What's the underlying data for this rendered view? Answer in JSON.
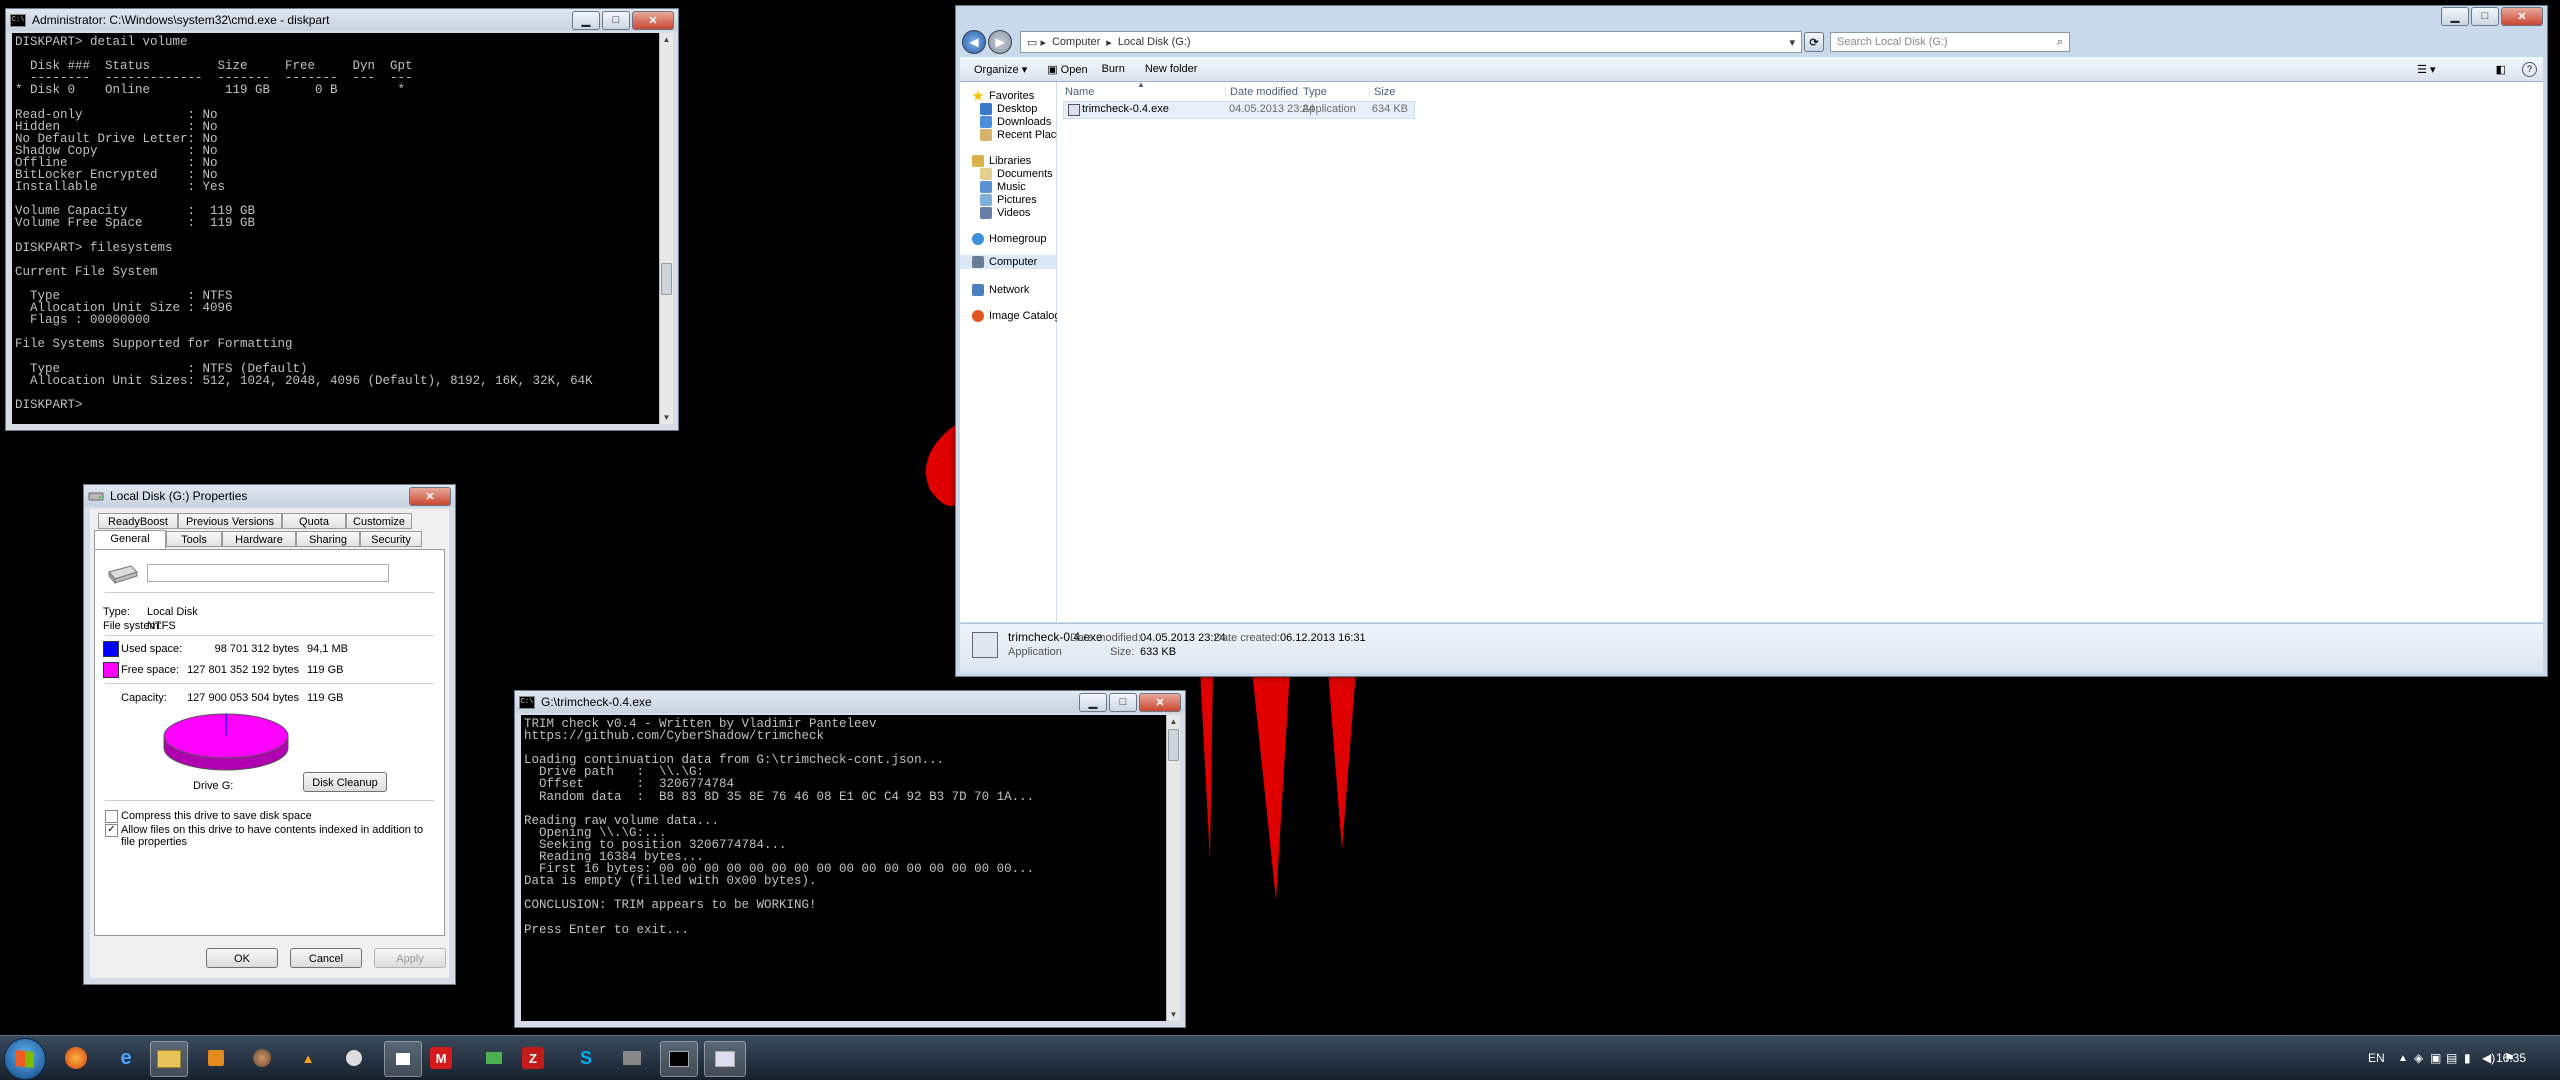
{
  "cmd_window": {
    "title": "Administrator: C:\\Windows\\system32\\cmd.exe - diskpart",
    "lines": [
      "DISKPART> detail volume",
      "",
      "  Disk ###  Status         Size     Free     Dyn  Gpt",
      "  --------  -------------  -------  -------  ---  ---",
      "* Disk 0    Online          119 GB      0 B        *",
      "",
      "Read-only              : No",
      "Hidden                 : No",
      "No Default Drive Letter: No",
      "Shadow Copy            : No",
      "Offline                : No",
      "BitLocker Encrypted    : No",
      "Installable            : Yes",
      "",
      "Volume Capacity        :  119 GB",
      "Volume Free Space      :  119 GB",
      "",
      "DISKPART> filesystems",
      "",
      "Current File System",
      "",
      "  Type                 : NTFS",
      "  Allocation Unit Size : 4096",
      "  Flags : 00000000",
      "",
      "File Systems Supported for Formatting",
      "",
      "  Type                 : NTFS (Default)",
      "  Allocation Unit Sizes: 512, 1024, 2048, 4096 (Default), 8192, 16K, 32K, 64K",
      "",
      "DISKPART>"
    ]
  },
  "trim_window": {
    "title": "G:\\trimcheck-0.4.exe",
    "lines": [
      "TRIM check v0.4 - Written by Vladimir Panteleev",
      "https://github.com/CyberShadow/trimcheck",
      "",
      "Loading continuation data from G:\\trimcheck-cont.json...",
      "  Drive path   :  \\\\.\\G:",
      "  Offset       :  3206774784",
      "  Random data  :  B8 83 8D 35 8E 76 46 08 E1 0C C4 92 B3 7D 70 1A...",
      "",
      "Reading raw volume data...",
      "  Opening \\\\.\\G:...",
      "  Seeking to position 3206774784...",
      "  Reading 16384 bytes...",
      "  First 16 bytes: 00 00 00 00 00 00 00 00 00 00 00 00 00 00 00 00...",
      "Data is empty (filled with 0x00 bytes).",
      "",
      "CONCLUSION: TRIM appears to be WORKING!",
      "",
      "Press Enter to exit..."
    ]
  },
  "properties": {
    "title": "Local Disk (G:) Properties",
    "tabs_row1": [
      "ReadyBoost",
      "Previous Versions",
      "Quota",
      "Customize"
    ],
    "tabs_row2": [
      "General",
      "Tools",
      "Hardware",
      "Sharing",
      "Security"
    ],
    "active_tab": "General",
    "volume_label": "",
    "type_label": "Type:",
    "type_value": "Local Disk",
    "fs_label": "File system:",
    "fs_value": "NTFS",
    "used_label": "Used space:",
    "used_bytes": "98 701 312 bytes",
    "used_size": "94,1 MB",
    "free_label": "Free space:",
    "free_bytes": "127 801 352 192 bytes",
    "free_size": "119 GB",
    "capacity_label": "Capacity:",
    "capacity_bytes": "127 900 053 504 bytes",
    "capacity_size": "119 GB",
    "drive_label": "Drive G:",
    "disk_cleanup": "Disk Cleanup",
    "compress_label": "Compress this drive to save disk space",
    "compress_checked": false,
    "index_label_1": "Allow files on this drive to have contents indexed in addition to",
    "index_label_2": "file properties",
    "index_checked": true,
    "ok": "OK",
    "cancel": "Cancel",
    "apply": "Apply",
    "used_fraction": 0.0008,
    "colors": {
      "used": "#0000ff",
      "free": "#ff00ff"
    }
  },
  "explorer": {
    "breadcrumb": [
      "Computer",
      "Local Disk (G:)"
    ],
    "search_placeholder": "Search Local Disk (G:)",
    "toolbar": {
      "organize": "Organize",
      "open": "Open",
      "burn": "Burn",
      "new_folder": "New folder"
    },
    "nav": {
      "favorites": "Favorites",
      "desktop": "Desktop",
      "downloads": "Downloads",
      "recent": "Recent Places",
      "libraries": "Libraries",
      "documents": "Documents",
      "music": "Music",
      "pictures": "Pictures",
      "videos": "Videos",
      "homegroup": "Homegroup",
      "computer": "Computer",
      "network": "Network",
      "image_catalog": "Image Catalog"
    },
    "columns": [
      "Name",
      "Date modified",
      "Type",
      "Size"
    ],
    "files": [
      {
        "name": "trimcheck-0.4.exe",
        "modified": "04.05.2013 23:24",
        "type": "Application",
        "size": "634 KB"
      }
    ],
    "details": {
      "name": "trimcheck-0.4.exe",
      "type": "Application",
      "modified_label": "Date modified:",
      "modified": "04.05.2013 23:24",
      "created_label": "Date created:",
      "created": "06.12.2013 16:31",
      "size_label": "Size:",
      "size": "633 KB"
    }
  },
  "taskbar": {
    "lang": "EN",
    "clock": "16:35"
  }
}
